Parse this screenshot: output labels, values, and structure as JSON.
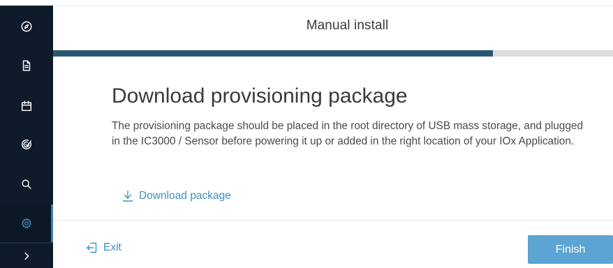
{
  "sidebar": {
    "items": [
      {
        "icon": "compass-icon"
      },
      {
        "icon": "document-icon"
      },
      {
        "icon": "calendar-icon"
      },
      {
        "icon": "target-check-icon"
      },
      {
        "icon": "search-icon"
      },
      {
        "icon": "gear-icon",
        "active": true
      }
    ],
    "expand_icon": "chevron-right-icon",
    "active_color": "#3e7fb3",
    "background_color": "#0d1b2b"
  },
  "header": {
    "title": "Manual install"
  },
  "progress": {
    "fraction": 0.785,
    "fill_color": "#2c5774",
    "track_color": "#dcdcdc"
  },
  "content": {
    "title": "Download provisioning package",
    "description": "The provisioning package should be placed in the root directory of USB mass storage, and plugged in the IC3000 / Sensor before powering it up or added in the right location of your IOx Application.",
    "download_label": "Download package",
    "download_icon": "download-icon"
  },
  "footer": {
    "exit_label": "Exit",
    "exit_icon": "exit-icon",
    "finish_label": "Finish"
  },
  "colors": {
    "link": "#3e91c4",
    "primary_button": "#5ba4d4"
  }
}
